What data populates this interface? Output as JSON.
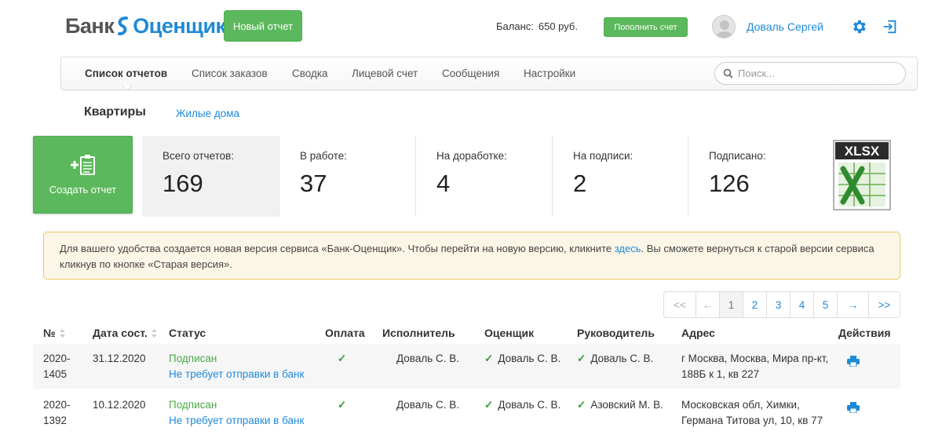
{
  "header": {
    "logo_part1": "Банк",
    "logo_part2": "Оценщик",
    "new_report_label": "Новый отчет",
    "balance_label": "Баланс:",
    "balance_value": "650 руб.",
    "topup_label": "Пополнить счет",
    "user_name": "Доваль Сергей"
  },
  "nav": {
    "items": [
      {
        "label": "Список отчетов",
        "active": true
      },
      {
        "label": "Список заказов"
      },
      {
        "label": "Сводка"
      },
      {
        "label": "Лицевой счет"
      },
      {
        "label": "Сообщения"
      },
      {
        "label": "Настройки"
      }
    ],
    "search_placeholder": "Поиск..."
  },
  "subtabs": {
    "active": "Квартиры",
    "other": "Жилые дома"
  },
  "stats": {
    "create_label": "Создать отчет",
    "items": [
      {
        "label": "Всего отчетов:",
        "value": "169"
      },
      {
        "label": "В работе:",
        "value": "37"
      },
      {
        "label": "На доработке:",
        "value": "4"
      },
      {
        "label": "На подписи:",
        "value": "2"
      },
      {
        "label": "Подписано:",
        "value": "126"
      }
    ],
    "export_label": "XLSX"
  },
  "notice": {
    "text_before": "Для вашего удобства создается новая версия сервиса «Банк-Оценщик». Чтобы перейти на новую версию, кликните ",
    "link": "здесь",
    "text_after": ". Вы сможете вернуться к старой версии сервиса кликнув по кнопке «Старая версия»."
  },
  "pagination": {
    "first": "<<",
    "prev": "←",
    "pages": [
      "1",
      "2",
      "3",
      "4",
      "5"
    ],
    "current": "1",
    "next": "→",
    "last": ">>"
  },
  "table": {
    "columns": [
      "№",
      "Дата сост.",
      "Статус",
      "Оплата",
      "Исполнитель",
      "Оценщик",
      "Руководитель",
      "Адрес",
      "Действия"
    ],
    "rows": [
      {
        "num_line1": "2020-",
        "num_line2": "1405",
        "date": "31.12.2020",
        "status": "Подписан",
        "status_note": "Не требует отправки в банк",
        "payment": "✓",
        "executor": "Доваль С. В.",
        "appraiser": "Доваль С. В.",
        "manager": "Доваль С. В.",
        "address_line1": "г Москва, Москва, Мира пр-кт,",
        "address_line2": "188Б к 1, кв 227"
      },
      {
        "num_line1": "2020-",
        "num_line2": "1392",
        "date": "10.12.2020",
        "status": "Подписан",
        "status_note": "Не требует отправки в банк",
        "payment": "✓",
        "executor": "Доваль С. В.",
        "appraiser": "Доваль С. В.",
        "manager": "Азовский М. В.",
        "address_line1": "Московская обл, Химки,",
        "address_line2": "Германа Титова ул, 10, кв 77"
      }
    ]
  },
  "colors": {
    "green": "#5cb85c",
    "blue": "#1e8ad6",
    "notice_bg": "#fcf6e6",
    "notice_border": "#f0c36d"
  }
}
